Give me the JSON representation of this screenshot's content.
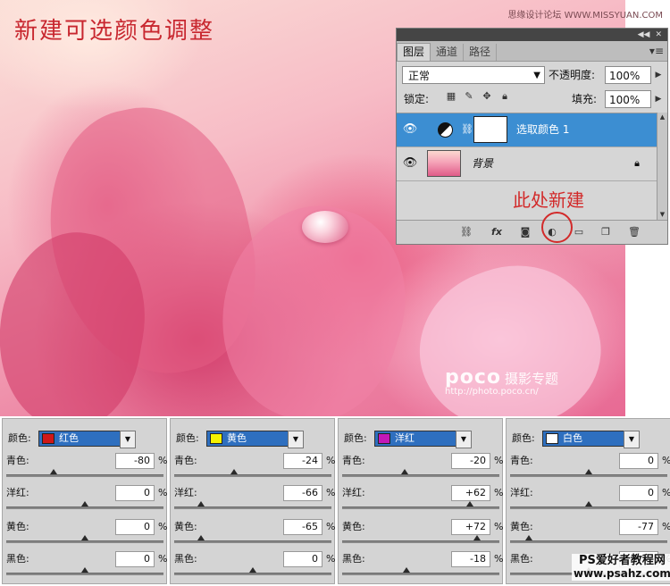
{
  "title": "新建可选颜色调整",
  "site_mark": "思缘设计论坛 WWW.MISSYUAN.COM",
  "watermark": {
    "brand": "poco",
    "sub": "摄影专题",
    "url": "http://photo.poco.cn/"
  },
  "annotation": "此处新建",
  "layers_panel": {
    "tabs": [
      "图层",
      "通道",
      "路径"
    ],
    "blend_mode": "正常",
    "opacity_label": "不透明度:",
    "opacity_value": "100%",
    "lock_label": "锁定:",
    "fill_label": "填充:",
    "fill_value": "100%",
    "layers": [
      {
        "name": "选取颜色 1",
        "selected": true
      },
      {
        "name": "背景",
        "selected": false
      }
    ]
  },
  "selective_color": {
    "colors_label": "颜色:",
    "sliders_labels": [
      "青色:",
      "洋红:",
      "黄色:",
      "黑色:"
    ],
    "panels": [
      {
        "color_name": "红色",
        "swatch": "#d01818",
        "values": [
          "-80",
          "0",
          "0",
          "0"
        ],
        "percent": [
          0.3,
          0.5,
          0.5,
          0.5
        ]
      },
      {
        "color_name": "黄色",
        "swatch": "#f5f200",
        "values": [
          "-24",
          "-66",
          "-65",
          "0"
        ],
        "percent": [
          0.38,
          0.17,
          0.17,
          0.5
        ]
      },
      {
        "color_name": "洋红",
        "swatch": "#c418b8",
        "values": [
          "-20",
          "+62",
          "+72",
          "-18"
        ],
        "percent": [
          0.4,
          0.81,
          0.86,
          0.41
        ]
      },
      {
        "color_name": "白色",
        "swatch": "#ffffff",
        "values": [
          "0",
          "0",
          "-77",
          ""
        ],
        "percent": [
          0.5,
          0.5,
          0.12,
          0.5
        ]
      }
    ],
    "percent_sign": "%"
  },
  "footer_brand": {
    "name": "PS爱好者教程网",
    "url": "www.psahz.com"
  }
}
